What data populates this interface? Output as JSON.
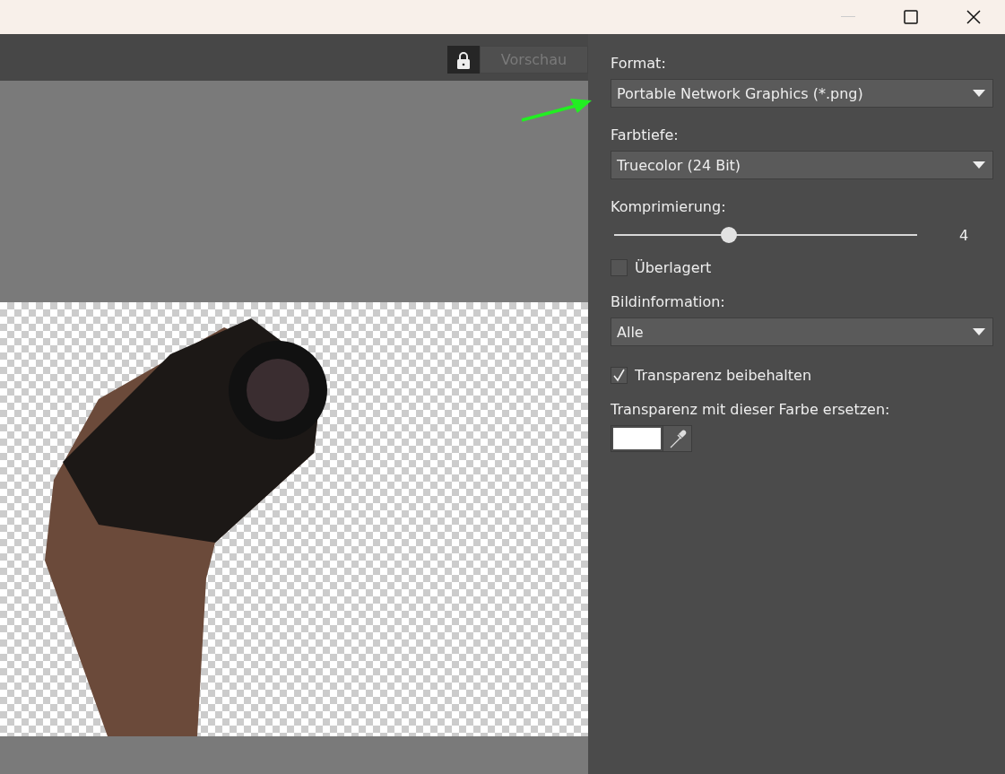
{
  "preview_toolbar": {
    "lock_active": true,
    "preview_button": {
      "label": "Vorschau",
      "disabled": true
    }
  },
  "settings": [
    {
      "kind": "dropdown",
      "label": "Format:",
      "value": "Portable Network Graphics (*.png)"
    },
    {
      "kind": "dropdown",
      "label": "Farbtiefe:",
      "value": "Truecolor (24 Bit)"
    },
    {
      "kind": "slider",
      "label": "Komprimierung:",
      "level": 0.38,
      "reading": "4"
    },
    {
      "kind": "checkbox",
      "label": "Überlagert",
      "checked": false
    },
    {
      "kind": "dropdown",
      "label": "Bildinformation:",
      "value": "Alle"
    },
    {
      "kind": "checkbox",
      "label": "Transparenz beibehalten",
      "checked": true
    },
    {
      "kind": "color",
      "label": "Transparenz mit dieser Farbe ersetzen:",
      "color": "#ffffff"
    }
  ]
}
